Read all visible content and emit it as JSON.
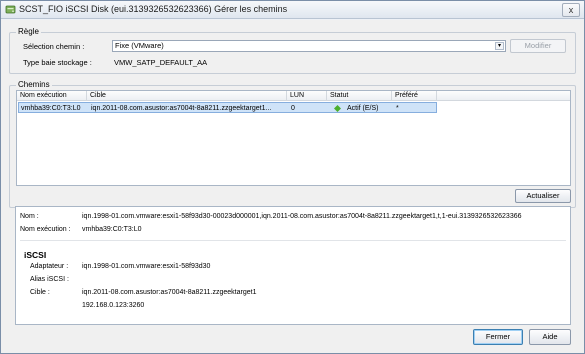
{
  "window": {
    "title": "SCST_FIO iSCSI Disk (eui.3139326532623366) Gérer les chemins",
    "close_glyph": "x"
  },
  "policy_group": {
    "label": "Règle",
    "path_selection_label": "Sélection chemin :",
    "path_selection_value": "Fixe (VMware)",
    "modify_button": "Modifier",
    "storage_type_label": "Type baie stockage :",
    "storage_type_value": "VMW_SATP_DEFAULT_AA"
  },
  "paths_group": {
    "label": "Chemins",
    "columns": [
      "Nom exécution",
      "Cible",
      "LUN",
      "Statut",
      "Préféré"
    ],
    "rows": [
      {
        "runtime_name": "vmhba39:C0:T3:L0",
        "target": "iqn.2011-08.com.asustor:as7004t-8a8211.zzgeektarget1...",
        "lun": "0",
        "status": "Actif (E/S)",
        "preferred": "*",
        "status_color": "#4caf2e"
      }
    ],
    "refresh_button": "Actualiser"
  },
  "details": {
    "name_label": "Nom :",
    "name_value": "iqn.1998-01.com.vmware:esxi1-58f93d30-00023d000001,iqn.2011-08.com.asustor:as7004t-8a8211.zzgeektarget1,t,1-eui.3139326532623366",
    "runtime_label": "Nom exécution :",
    "runtime_value": "vmhba39:C0:T3:L0",
    "section_title": "iSCSI",
    "adapter_label": "Adaptateur :",
    "adapter_value": "iqn.1998-01.com.vmware:esxi1-58f93d30",
    "alias_label": "Alias iSCSI :",
    "alias_value": "",
    "target_label": "Cible :",
    "target_value": "iqn.2011-08.com.asustor:as7004t-8a8211.zzgeektarget1",
    "target_address": "192.168.0.123:3260"
  },
  "footer": {
    "close_button": "Fermer",
    "help_button": "Aide"
  }
}
